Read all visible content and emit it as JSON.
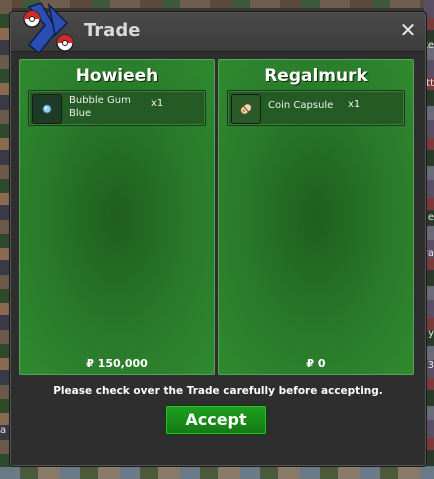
{
  "window": {
    "title": "Trade",
    "close_label": "✕"
  },
  "players": [
    {
      "name": "Howieeh",
      "item": {
        "name": "Bubble Gum Blue",
        "name_line1": "Bubble Gum",
        "name_line2": "Blue",
        "qty": "x1",
        "icon": "bubble-gum-icon"
      },
      "money": "₽ 150,000"
    },
    {
      "name": "Regalmurk",
      "item": {
        "name": "Coin Capsule",
        "qty": "x1",
        "icon": "coin-capsule-icon"
      },
      "money": "₽ 0"
    }
  ],
  "notice": "Please check over the Trade carefully before accepting.",
  "accept_label": "Accept",
  "background_text": {
    "r1": "ke",
    "r2": "tt",
    "r3": "e",
    "r4": "ra",
    "r5": "(y",
    "r6": "3",
    "r7": "a"
  }
}
